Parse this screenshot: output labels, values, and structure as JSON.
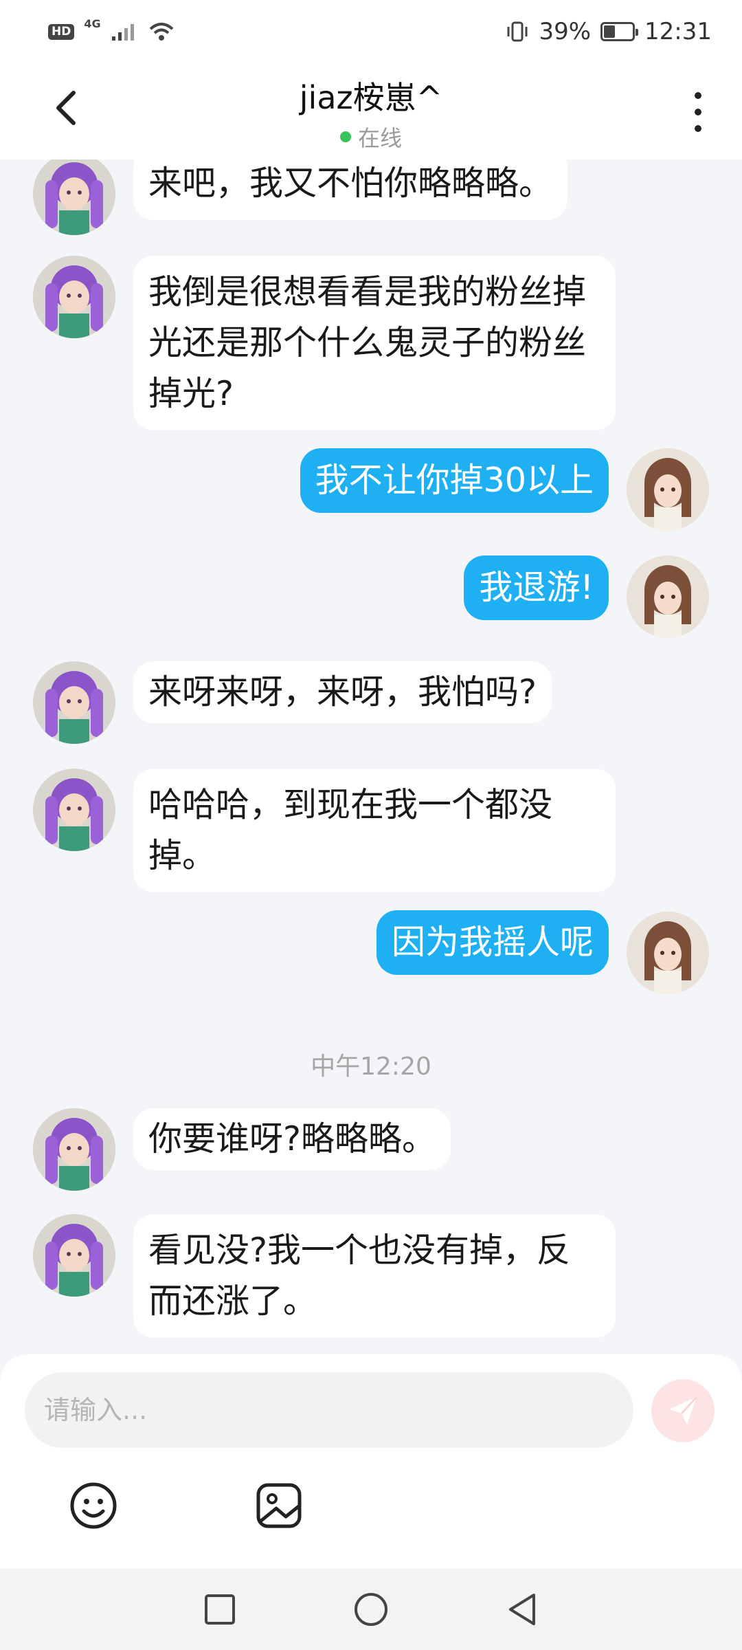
{
  "status_bar": {
    "hd_badge": "HD",
    "network": "4G",
    "battery_percent_label": "39%",
    "battery_level": 0.39,
    "time": "12:31"
  },
  "header": {
    "title": "jiaz桉崽^",
    "presence_text": "在线",
    "presence_color": "#39c35a"
  },
  "messages": [
    {
      "sender": "other",
      "text": "来吧，我又不怕你略略略。"
    },
    {
      "sender": "other",
      "text": "我倒是很想看看是我的粉丝掉光还是那个什么鬼灵子的粉丝掉光?"
    },
    {
      "sender": "me",
      "text": "我不让你掉30以上"
    },
    {
      "sender": "me",
      "text": "我退游!"
    },
    {
      "sender": "other",
      "text": "来呀来呀，来呀，我怕吗?"
    },
    {
      "sender": "other",
      "text": "哈哈哈，到现在我一个都没掉。"
    },
    {
      "sender": "me",
      "text": "因为我摇人呢"
    },
    {
      "sender": "other",
      "text": "你要谁呀?略略略。"
    },
    {
      "sender": "other",
      "text": "看见没?我一个也没有掉，反而还涨了。"
    }
  ],
  "time_separator": "中午12:20",
  "composer": {
    "placeholder": "请输入...",
    "send_icon": "paper-plane-icon",
    "tools": [
      "emoji-icon",
      "image-icon"
    ]
  },
  "colors": {
    "my_bubble": "#1fb0f4",
    "other_bubble": "#ffffff",
    "background": "#f3f5f8",
    "send_button_bg": "#fde4e4"
  },
  "navbar": [
    "recents-square-icon",
    "home-circle-icon",
    "back-triangle-icon"
  ]
}
